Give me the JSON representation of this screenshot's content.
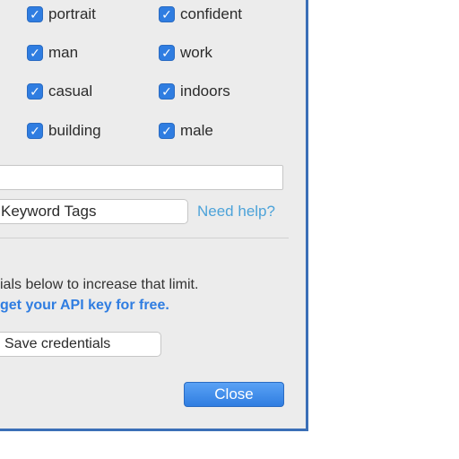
{
  "tags": [
    {
      "label": "portrait",
      "checked": true
    },
    {
      "label": "confident",
      "checked": true
    },
    {
      "label": "man",
      "checked": true
    },
    {
      "label": "work",
      "checked": true
    },
    {
      "label": "casual",
      "checked": true
    },
    {
      "label": "indoors",
      "checked": true
    },
    {
      "label": "building",
      "checked": true
    },
    {
      "label": "male",
      "checked": true
    }
  ],
  "form": {
    "keyword_field_value": "",
    "keyword_button_label": "Keyword Tags",
    "help_link": "Need help?"
  },
  "credentials": {
    "info_text": "ials below to increase that limit.",
    "api_link": "get your API key for free.",
    "save_label": "Save credentials"
  },
  "footer": {
    "close_label": "Close"
  },
  "colors": {
    "accent": "#2f7de1",
    "link": "#4da3d9",
    "window_border": "#3b6fb7"
  },
  "icons": {
    "checkbox": "check-icon"
  }
}
